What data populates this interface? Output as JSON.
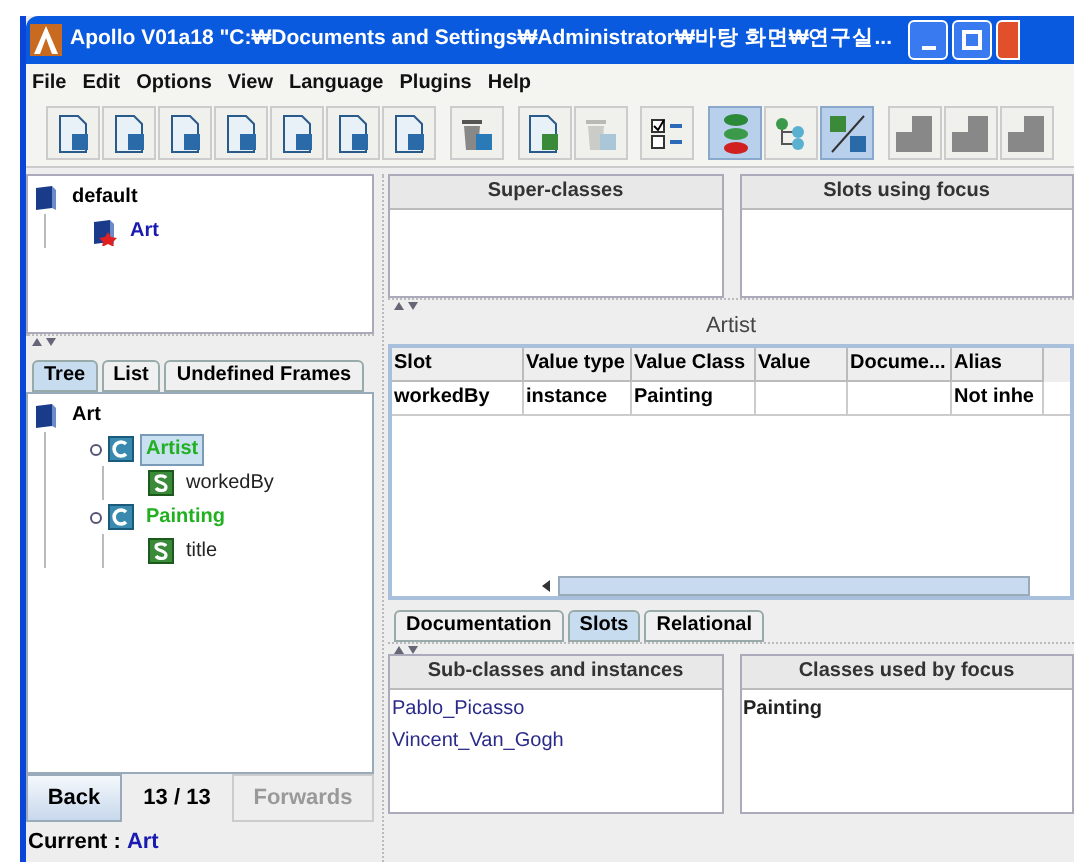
{
  "window": {
    "title": "Apollo V01a18 \"C:₩Documents and Settings₩Administrator₩바탕 화면₩연구실..."
  },
  "menu": [
    "File",
    "Edit",
    "Options",
    "View",
    "Language",
    "Plugins",
    "Help"
  ],
  "toolbar": [
    {
      "kind": "doc",
      "selected": false,
      "disabled": false
    },
    {
      "kind": "doc",
      "selected": false,
      "disabled": false
    },
    {
      "kind": "doc",
      "selected": false,
      "disabled": false
    },
    {
      "kind": "doc",
      "selected": false,
      "disabled": false
    },
    {
      "kind": "doc",
      "selected": false,
      "disabled": false
    },
    {
      "kind": "doc",
      "selected": false,
      "disabled": false
    },
    {
      "kind": "doc",
      "selected": false,
      "disabled": false
    },
    {
      "kind": "sep"
    },
    {
      "kind": "trash",
      "selected": false,
      "disabled": false
    },
    {
      "kind": "sep"
    },
    {
      "kind": "slotdoc",
      "selected": false,
      "disabled": false
    },
    {
      "kind": "trash",
      "selected": false,
      "disabled": true
    },
    {
      "kind": "sep"
    },
    {
      "kind": "checklist",
      "selected": false,
      "disabled": false
    },
    {
      "kind": "sep"
    },
    {
      "kind": "stack",
      "selected": true,
      "disabled": false
    },
    {
      "kind": "tree",
      "selected": false,
      "disabled": false
    },
    {
      "kind": "slotlink",
      "selected": true,
      "disabled": false
    },
    {
      "kind": "sep"
    },
    {
      "kind": "layout",
      "selected": false,
      "disabled": false
    },
    {
      "kind": "layout",
      "selected": false,
      "disabled": false
    },
    {
      "kind": "layout",
      "selected": false,
      "disabled": false
    }
  ],
  "project_tree": [
    {
      "label": "default",
      "kind": "project",
      "children": [
        {
          "label": "Art",
          "kind": "ontology"
        }
      ]
    }
  ],
  "left_tabs": [
    {
      "label": "Tree",
      "selected": true
    },
    {
      "label": "List",
      "selected": false
    },
    {
      "label": "Undefined Frames",
      "selected": false
    }
  ],
  "class_tree": [
    {
      "label": "Art",
      "kind": "project",
      "selected": false,
      "children": [
        {
          "label": "Artist",
          "kind": "class",
          "selected": true,
          "children": [
            {
              "label": "workedBy",
              "kind": "slot",
              "selected": false
            }
          ]
        },
        {
          "label": "Painting",
          "kind": "class",
          "selected": false,
          "children": [
            {
              "label": "title",
              "kind": "slot",
              "selected": false
            }
          ]
        }
      ]
    }
  ],
  "nav": {
    "back": "Back",
    "position": "13 / 13",
    "forwards": "Forwards",
    "forwards_disabled": true
  },
  "status_bar": {
    "label": "Current :",
    "value": "Art"
  },
  "super_classes": {
    "title": "Super-classes"
  },
  "slots_using_focus": {
    "title": "Slots using focus"
  },
  "focus_title": "Artist",
  "table": {
    "columns": [
      "Slot",
      "Value type",
      "Value Class",
      "Value",
      "Docume...",
      "Alias"
    ],
    "rows": [
      {
        "cells": [
          "workedBy",
          "instance",
          "Painting",
          null,
          null,
          "Not inhe"
        ]
      }
    ]
  },
  "bottom_tabs": [
    {
      "label": "Documentation",
      "selected": false
    },
    {
      "label": "Slots",
      "selected": true
    },
    {
      "label": "Relational",
      "selected": false
    }
  ],
  "sub_classes": {
    "title": "Sub-classes and instances",
    "items": [
      "Pablo_Picasso",
      "Vincent_Van_Gogh"
    ]
  },
  "classes_used": {
    "title": "Classes used by focus",
    "items": [
      "Painting"
    ]
  }
}
